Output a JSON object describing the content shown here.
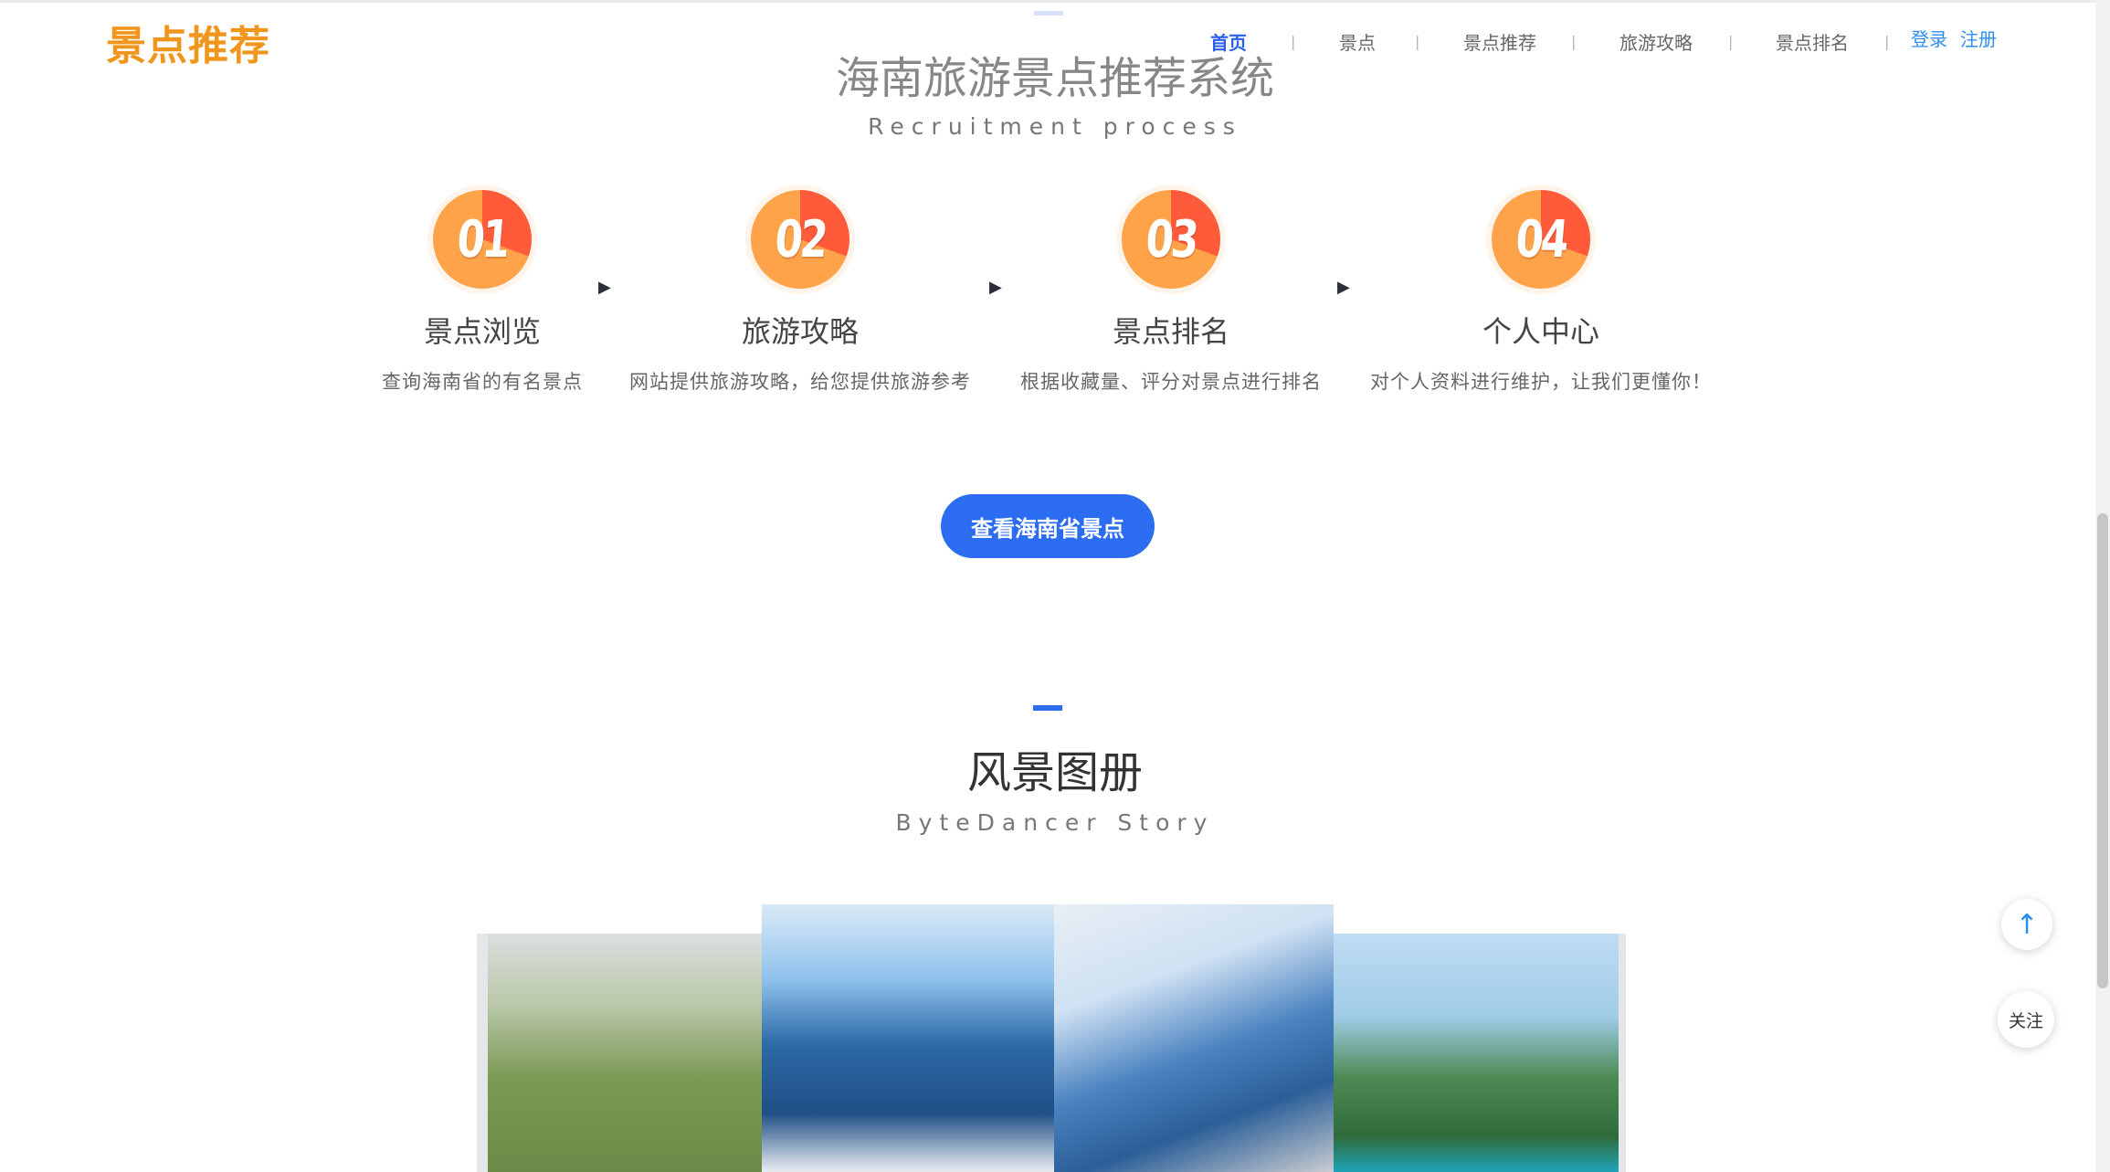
{
  "header": {
    "logo": "景点推荐",
    "nav": [
      "首页",
      "景点",
      "景点推荐",
      "旅游攻略",
      "景点排名"
    ],
    "separator": "|",
    "login": "登录",
    "register": "注册"
  },
  "section1": {
    "title": "海南旅游景点推荐系统",
    "subtitle": "Recruitment process",
    "steps": [
      {
        "num": "01",
        "title": "景点浏览",
        "desc": "查询海南省的有名景点"
      },
      {
        "num": "02",
        "title": "旅游攻略",
        "desc": "网站提供旅游攻略，给您提供旅游参考"
      },
      {
        "num": "03",
        "title": "景点排名",
        "desc": "根据收藏量、评分对景点进行排名"
      },
      {
        "num": "04",
        "title": "个人中心",
        "desc": "对个人资料进行维护，让我们更懂你！"
      }
    ],
    "arrow": "▶",
    "cta": "查看海南省景点"
  },
  "section2": {
    "title": "风景图册",
    "subtitle": "ByteDancer Story"
  },
  "float": {
    "up": "↑",
    "follow": "关注"
  },
  "colors": {
    "primary": "#2c6cf1",
    "logo": "#f0961c",
    "badge_orange": "#ffa34a",
    "badge_red": "#ff5b3a"
  },
  "icons": [
    "up-arrow-icon",
    "step-arrow-icon"
  ]
}
